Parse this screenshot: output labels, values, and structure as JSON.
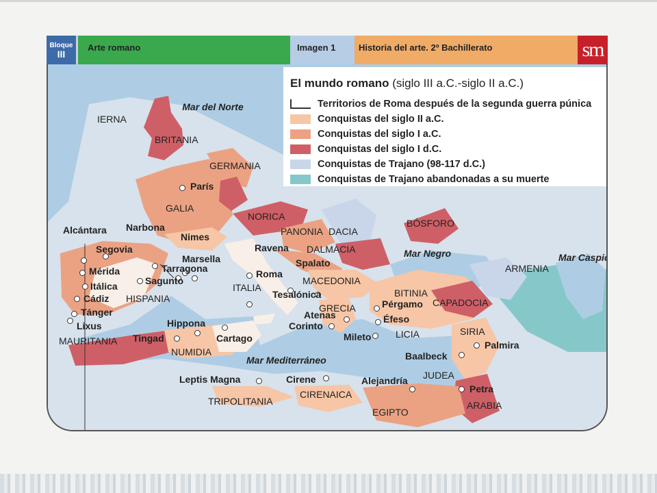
{
  "header": {
    "bloque_label": "Bloque",
    "bloque_number": "III",
    "section": "Arte romano",
    "image_label": "Imagen 1",
    "course": "Historia del arte. 2º Bachillerato",
    "publisher_logo_text": "sm"
  },
  "legend": {
    "title_bold": "El mundo romano",
    "title_normal": "(siglo III a.C.-siglo II a.C.)",
    "items": [
      {
        "label": "Territorios de Roma después de la segunda guerra púnica",
        "color": "#ffffff"
      },
      {
        "label": "Conquistas del siglo II a.C.",
        "color": "#f6c6a6"
      },
      {
        "label": "Conquistas del siglo I a.C.",
        "color": "#eba283"
      },
      {
        "label": "Conquistas del siglo I d.C.",
        "color": "#cf5f67"
      },
      {
        "label": "Conquistas de Trajano (98-117 d.C.)",
        "color": "#c9d6ea"
      },
      {
        "label": "Conquistas de Trajano abandonadas a su muerte",
        "color": "#86c8c9"
      }
    ]
  },
  "seas": {
    "mar_del_norte": "Mar del Norte",
    "mar_negro": "Mar Negro",
    "mar_caspio": "Mar Caspio",
    "mar_mediterraneo": "Mar Mediterráneo"
  },
  "regions": {
    "ierna": "IERNA",
    "britania": "BRITANIA",
    "germania": "GERMANIA",
    "galia": "GALIA",
    "norica": "NORICA",
    "panonia": "PANONIA",
    "dacia": "DACIA",
    "dalmacia": "DALMACIA",
    "bosforo": "BÓSFORO",
    "armenia": "ARMENIA",
    "macedonia": "MACEDONIA",
    "italia": "ITALIA",
    "hispania": "HISPANIA",
    "grecia": "GRECIA",
    "bitinia": "BITINIA",
    "capadocia": "CAPADOCIA",
    "licia": "LICIA",
    "siria": "SIRIA",
    "mauritania": "MAURITANIA",
    "numidia": "NUMIDIA",
    "judea": "JUDEA",
    "tripolitania": "TRIPOLITANIA",
    "cirenaica": "CIRENAICA",
    "egipto": "EGIPTO",
    "arabia": "ARABIA"
  },
  "cities": {
    "paris": "París",
    "alcantara": "Alcántara",
    "narbona": "Narbona",
    "nimes": "Nimes",
    "segovia": "Segovia",
    "marsella": "Marsella",
    "ravena": "Ravena",
    "merida": "Mérida",
    "tarragona": "Tarragona",
    "spalato": "Spalato",
    "italica": "Itálica",
    "sagunto": "Sagunto",
    "roma": "Roma",
    "cadiz": "Cádiz",
    "tesalonica": "Tesalónica",
    "tanger": "Tánger",
    "lixus": "Lixus",
    "atenas": "Atenas",
    "pergamo": "Pérgamo",
    "efeso": "Éfeso",
    "corinto": "Corinto",
    "mileto": "Mileto",
    "hippona": "Hippona",
    "tingad": "Tingad",
    "cartago": "Cartago",
    "palmira": "Palmira",
    "baalbeck": "Baalbeck",
    "leptis_magna": "Leptis Magna",
    "cirene": "Cirene",
    "alejandria": "Alejandría",
    "petra": "Petra"
  }
}
